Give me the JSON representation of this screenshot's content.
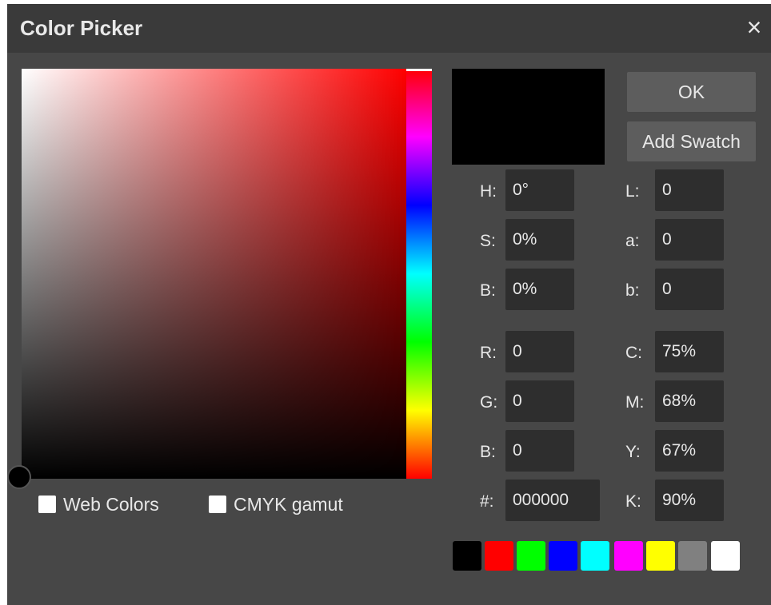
{
  "window": {
    "title": "Color Picker",
    "close_glyph": "×",
    "close_icon": "close-icon"
  },
  "hue": {
    "degrees": 0
  },
  "current_color": "#000000",
  "buttons": {
    "ok": "OK",
    "add_swatch": "Add Swatch"
  },
  "fields": {
    "h": {
      "label": "H:",
      "value": "0°"
    },
    "s": {
      "label": "S:",
      "value": "0%"
    },
    "bright": {
      "label": "B:",
      "value": "0%"
    },
    "r": {
      "label": "R:",
      "value": "0"
    },
    "g": {
      "label": "G:",
      "value": "0"
    },
    "blue": {
      "label": "B:",
      "value": "0"
    },
    "hex": {
      "label": "#:",
      "value": "000000"
    },
    "l": {
      "label": "L:",
      "value": "0"
    },
    "a": {
      "label": "a:",
      "value": "0"
    },
    "lab_b": {
      "label": "b:",
      "value": "0"
    },
    "c": {
      "label": "C:",
      "value": "75%"
    },
    "m": {
      "label": "M:",
      "value": "68%"
    },
    "y": {
      "label": "Y:",
      "value": "67%"
    },
    "k": {
      "label": "K:",
      "value": "90%"
    }
  },
  "checkboxes": {
    "web_colors": "Web Colors",
    "cmyk_gamut": "CMYK gamut"
  },
  "swatches": [
    "#000000",
    "#ff0000",
    "#00ff00",
    "#0000ff",
    "#00ffff",
    "#ff00ff",
    "#ffff00",
    "#808080",
    "#ffffff"
  ]
}
